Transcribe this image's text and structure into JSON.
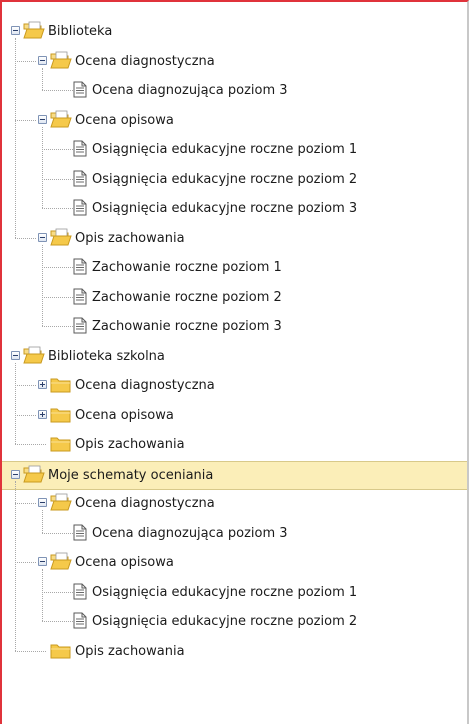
{
  "tree": {
    "nodes": [
      {
        "label": "Biblioteka",
        "level": 0,
        "type": "folder",
        "state": "expanded",
        "icon": "folder-open-icon"
      },
      {
        "label": "Ocena diagnostyczna",
        "level": 1,
        "type": "folder",
        "state": "expanded",
        "icon": "folder-open-icon"
      },
      {
        "label": "Ocena diagnozująca poziom 3",
        "level": 2,
        "type": "document",
        "icon": "document-icon"
      },
      {
        "label": "Ocena opisowa",
        "level": 1,
        "type": "folder",
        "state": "expanded",
        "icon": "folder-open-icon"
      },
      {
        "label": "Osiągnięcia edukacyjne roczne poziom 1",
        "level": 2,
        "type": "document",
        "icon": "document-icon"
      },
      {
        "label": "Osiągnięcia edukacyjne roczne poziom 2",
        "level": 2,
        "type": "document",
        "icon": "document-icon"
      },
      {
        "label": "Osiągnięcia edukacyjne roczne poziom 3",
        "level": 2,
        "type": "document",
        "icon": "document-icon"
      },
      {
        "label": "Opis zachowania",
        "level": 1,
        "type": "folder",
        "state": "expanded",
        "icon": "folder-open-icon"
      },
      {
        "label": "Zachowanie roczne poziom 1",
        "level": 2,
        "type": "document",
        "icon": "document-icon"
      },
      {
        "label": "Zachowanie roczne poziom 2",
        "level": 2,
        "type": "document",
        "icon": "document-icon"
      },
      {
        "label": "Zachowanie roczne poziom 3",
        "level": 2,
        "type": "document",
        "icon": "document-icon"
      },
      {
        "label": "Biblioteka szkolna",
        "level": 0,
        "type": "folder",
        "state": "expanded",
        "icon": "folder-open-icon"
      },
      {
        "label": "Ocena diagnostyczna",
        "level": 1,
        "type": "folder",
        "state": "collapsed",
        "icon": "folder-closed-icon"
      },
      {
        "label": "Ocena opisowa",
        "level": 1,
        "type": "folder",
        "state": "collapsed",
        "icon": "folder-closed-icon"
      },
      {
        "label": "Opis zachowania",
        "level": 1,
        "type": "folder",
        "state": "leaf",
        "icon": "folder-closed-icon"
      },
      {
        "label": "Moje schematy oceniania",
        "level": 0,
        "type": "folder",
        "state": "expanded",
        "icon": "folder-open-icon",
        "selected": true
      },
      {
        "label": "Ocena diagnostyczna",
        "level": 1,
        "type": "folder",
        "state": "expanded",
        "icon": "folder-open-icon"
      },
      {
        "label": "Ocena diagnozująca poziom 3",
        "level": 2,
        "type": "document",
        "icon": "document-icon"
      },
      {
        "label": "Ocena opisowa",
        "level": 1,
        "type": "folder",
        "state": "expanded",
        "icon": "folder-open-icon"
      },
      {
        "label": "Osiągnięcia edukacyjne roczne poziom 1",
        "level": 2,
        "type": "document",
        "icon": "document-icon"
      },
      {
        "label": "Osiągnięcia edukacyjne roczne poziom 2",
        "level": 2,
        "type": "document",
        "icon": "document-icon"
      },
      {
        "label": "Opis zachowania",
        "level": 1,
        "type": "folder",
        "state": "leaf",
        "icon": "folder-closed-icon"
      }
    ]
  },
  "colors": {
    "frame_border": "#e0333b",
    "selected_background": "#fbeeb8",
    "folder_body": "#f5c94a",
    "folder_edge": "#c99a1f",
    "document_border": "#5a5a5a"
  }
}
